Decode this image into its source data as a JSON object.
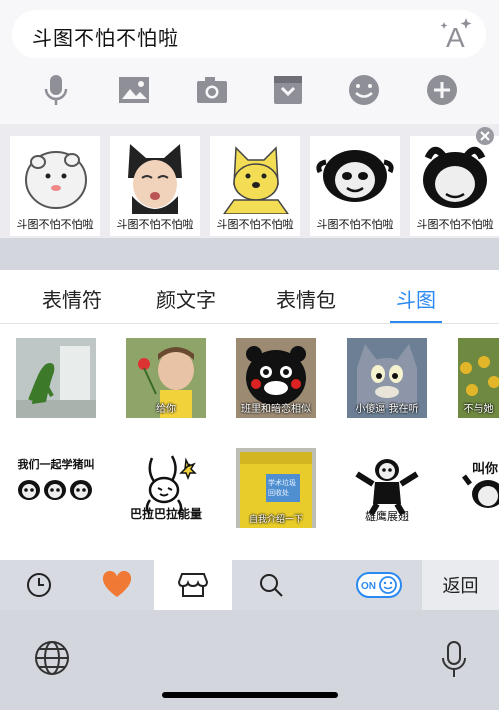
{
  "input": {
    "text": "斗图不怕不怕啦",
    "font_button_icon": "font-size-icon"
  },
  "toolbar": {
    "icons": [
      "microphone-icon",
      "image-icon",
      "camera-icon",
      "inbox-icon",
      "emoji-icon",
      "plus-icon"
    ]
  },
  "suggestions": [
    {
      "caption": "斗图不怕不怕啦",
      "icon": "hamster-sticker"
    },
    {
      "caption": "斗图不怕不怕啦",
      "icon": "cat-kid-sticker"
    },
    {
      "caption": "斗图不怕不怕啦",
      "icon": "doge-sticker"
    },
    {
      "caption": "斗图不怕不怕啦",
      "icon": "panda-sticker"
    },
    {
      "caption": "斗图不怕不怕啦",
      "icon": "panda-cover-eyes-sticker"
    }
  ],
  "tabs": [
    {
      "label": "表情符",
      "active": false
    },
    {
      "label": "颜文字",
      "active": false
    },
    {
      "label": "表情包",
      "active": false
    },
    {
      "label": "斗图",
      "active": true
    }
  ],
  "grid_row1": [
    {
      "caption": "",
      "icon": "frog-sticker"
    },
    {
      "caption": "给你",
      "icon": "baby-flower-sticker"
    },
    {
      "caption": "班里和暗恋相似",
      "icon": "kumamon-sticker"
    },
    {
      "caption": "小傻逼 我在听",
      "icon": "tom-cat-sticker"
    },
    {
      "caption": "不与她",
      "icon": "sunflower-field-sticker"
    }
  ],
  "grid_row2": [
    {
      "caption": "我们一起学猪叫",
      "icon": "pandas-row-sticker"
    },
    {
      "caption": "巴拉巴拉能量",
      "icon": "bunny-sticker"
    },
    {
      "caption": "自我介绍一下",
      "sign": "学术垃圾\n回收处",
      "icon": "trash-bin-sticker"
    },
    {
      "caption": "雄鹰展翅",
      "icon": "panda-eagle-sticker"
    },
    {
      "caption": "叫你",
      "icon": "panda-partial-sticker"
    }
  ],
  "bottombar": {
    "icons": [
      "clock-icon",
      "heart-icon",
      "store-icon",
      "search-icon",
      "toggle-on-icon"
    ],
    "toggle_label": "ON",
    "back_label": "返回"
  },
  "system": {
    "icons": [
      "globe-icon",
      "microphone-icon"
    ]
  },
  "colors": {
    "accent_blue": "#2b8af2",
    "heart_orange": "#f07a35",
    "icon_gray": "#8f8f97"
  }
}
